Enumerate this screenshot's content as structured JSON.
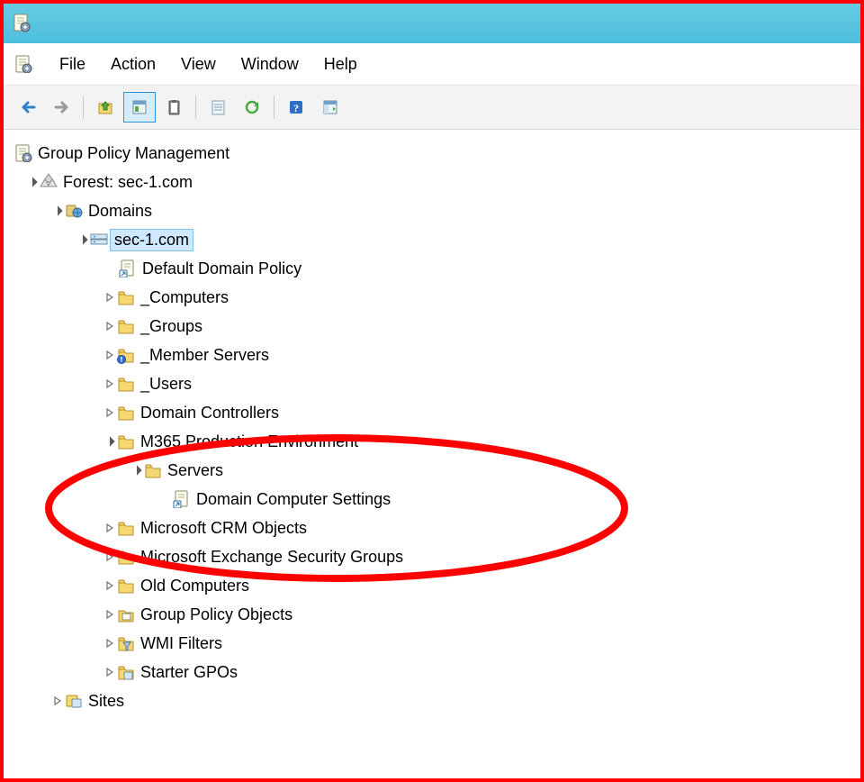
{
  "menu": {
    "file": "File",
    "action": "Action",
    "view": "View",
    "window": "Window",
    "help": "Help"
  },
  "tree": {
    "root": "Group Policy Management",
    "forest": "Forest: sec-1.com",
    "domains": "Domains",
    "domain": "sec-1.com",
    "default_policy": "Default Domain Policy",
    "computers": "_Computers",
    "groups": "_Groups",
    "member_servers": "_Member Servers",
    "users": "_Users",
    "domain_controllers": "Domain Controllers",
    "m365": "M365 Production Environment",
    "servers": "Servers",
    "dcs": "Domain Computer Settings",
    "mscrm": "Microsoft CRM Objects",
    "msexch": "Microsoft Exchange Security Groups",
    "oldcomp": "Old Computers",
    "gpo": "Group Policy Objects",
    "wmi": "WMI Filters",
    "starter": "Starter GPOs",
    "sites": "Sites"
  }
}
